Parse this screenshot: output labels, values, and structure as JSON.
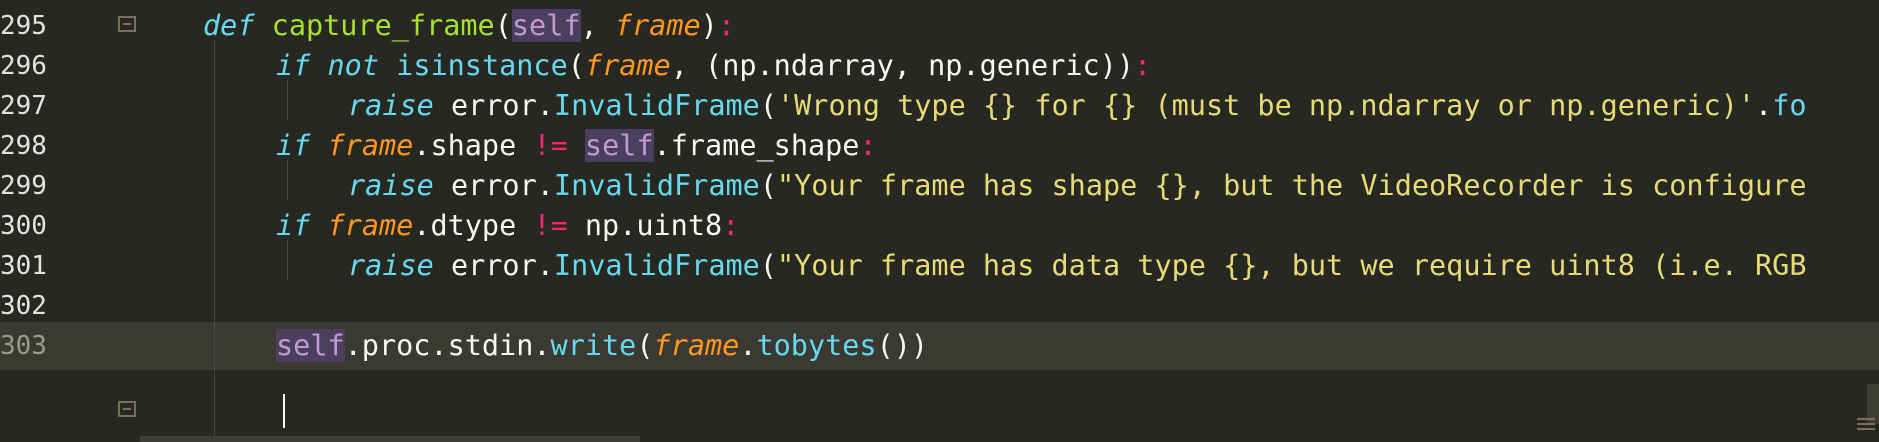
{
  "editor": {
    "lines": [
      {
        "number": "295",
        "current": false,
        "indent": 210,
        "fold": true,
        "tokens": [
          {
            "t": "def",
            "c": "kw"
          },
          {
            "t": " ",
            "c": "pl"
          },
          {
            "t": "capture_frame",
            "c": "fn"
          },
          {
            "t": "(",
            "c": "pl"
          },
          {
            "t": "self",
            "c": "selfp"
          },
          {
            "t": ", ",
            "c": "pl"
          },
          {
            "t": "frame",
            "c": "param"
          },
          {
            "t": ")",
            "c": "pl"
          },
          {
            "t": ":",
            "c": "op"
          }
        ]
      },
      {
        "number": "296",
        "current": false,
        "indent": 283,
        "fold": false,
        "tokens": [
          {
            "t": "if",
            "c": "kw"
          },
          {
            "t": " ",
            "c": "pl"
          },
          {
            "t": "not",
            "c": "kw"
          },
          {
            "t": " ",
            "c": "pl"
          },
          {
            "t": "isinstance",
            "c": "call"
          },
          {
            "t": "(",
            "c": "pl"
          },
          {
            "t": "frame",
            "c": "param"
          },
          {
            "t": ", (np.ndarray, np.generic))",
            "c": "pl"
          },
          {
            "t": ":",
            "c": "op"
          }
        ]
      },
      {
        "number": "297",
        "current": false,
        "indent": 355,
        "fold": false,
        "tokens": [
          {
            "t": "raise",
            "c": "kw"
          },
          {
            "t": " error.",
            "c": "pl"
          },
          {
            "t": "InvalidFrame",
            "c": "call"
          },
          {
            "t": "(",
            "c": "pl"
          },
          {
            "t": "'Wrong type {} for {} (must be np.ndarray or np.generic)'",
            "c": "str"
          },
          {
            "t": ".",
            "c": "pl"
          },
          {
            "t": "fo",
            "c": "call"
          }
        ]
      },
      {
        "number": "298",
        "current": false,
        "indent": 283,
        "fold": false,
        "tokens": [
          {
            "t": "if",
            "c": "kw"
          },
          {
            "t": " ",
            "c": "pl"
          },
          {
            "t": "frame",
            "c": "param"
          },
          {
            "t": ".shape ",
            "c": "pl"
          },
          {
            "t": "!=",
            "c": "op"
          },
          {
            "t": " ",
            "c": "pl"
          },
          {
            "t": "self",
            "c": "selfp"
          },
          {
            "t": ".frame_shape",
            "c": "pl"
          },
          {
            "t": ":",
            "c": "op"
          }
        ]
      },
      {
        "number": "299",
        "current": false,
        "indent": 355,
        "fold": false,
        "tokens": [
          {
            "t": "raise",
            "c": "kw"
          },
          {
            "t": " error.",
            "c": "pl"
          },
          {
            "t": "InvalidFrame",
            "c": "call"
          },
          {
            "t": "(",
            "c": "pl"
          },
          {
            "t": "\"Your frame has shape {}, but the VideoRecorder is configure",
            "c": "str"
          }
        ]
      },
      {
        "number": "300",
        "current": false,
        "indent": 283,
        "fold": false,
        "tokens": [
          {
            "t": "if",
            "c": "kw"
          },
          {
            "t": " ",
            "c": "pl"
          },
          {
            "t": "frame",
            "c": "param"
          },
          {
            "t": ".dtype ",
            "c": "pl"
          },
          {
            "t": "!=",
            "c": "op"
          },
          {
            "t": " np.uint8",
            "c": "pl"
          },
          {
            "t": ":",
            "c": "op"
          }
        ]
      },
      {
        "number": "301",
        "current": false,
        "indent": 355,
        "fold": false,
        "tokens": [
          {
            "t": "raise",
            "c": "kw"
          },
          {
            "t": " error.",
            "c": "pl"
          },
          {
            "t": "InvalidFrame",
            "c": "call"
          },
          {
            "t": "(",
            "c": "pl"
          },
          {
            "t": "\"Your frame has data type {}, but we require uint8 (i.e. RGB",
            "c": "str"
          }
        ]
      },
      {
        "number": "302",
        "current": false,
        "indent": 283,
        "fold": false,
        "tokens": []
      },
      {
        "number": "303",
        "current": true,
        "indent": 283,
        "fold": true,
        "tokens": [
          {
            "t": "self",
            "c": "selfp"
          },
          {
            "t": ".proc.stdin.",
            "c": "pl"
          },
          {
            "t": "write",
            "c": "call"
          },
          {
            "t": "(",
            "c": "pl"
          },
          {
            "t": "frame",
            "c": "param"
          },
          {
            "t": ".",
            "c": "pl"
          },
          {
            "t": "tobytes",
            "c": "call"
          },
          {
            "t": "())",
            "c": "pl"
          }
        ]
      }
    ]
  }
}
